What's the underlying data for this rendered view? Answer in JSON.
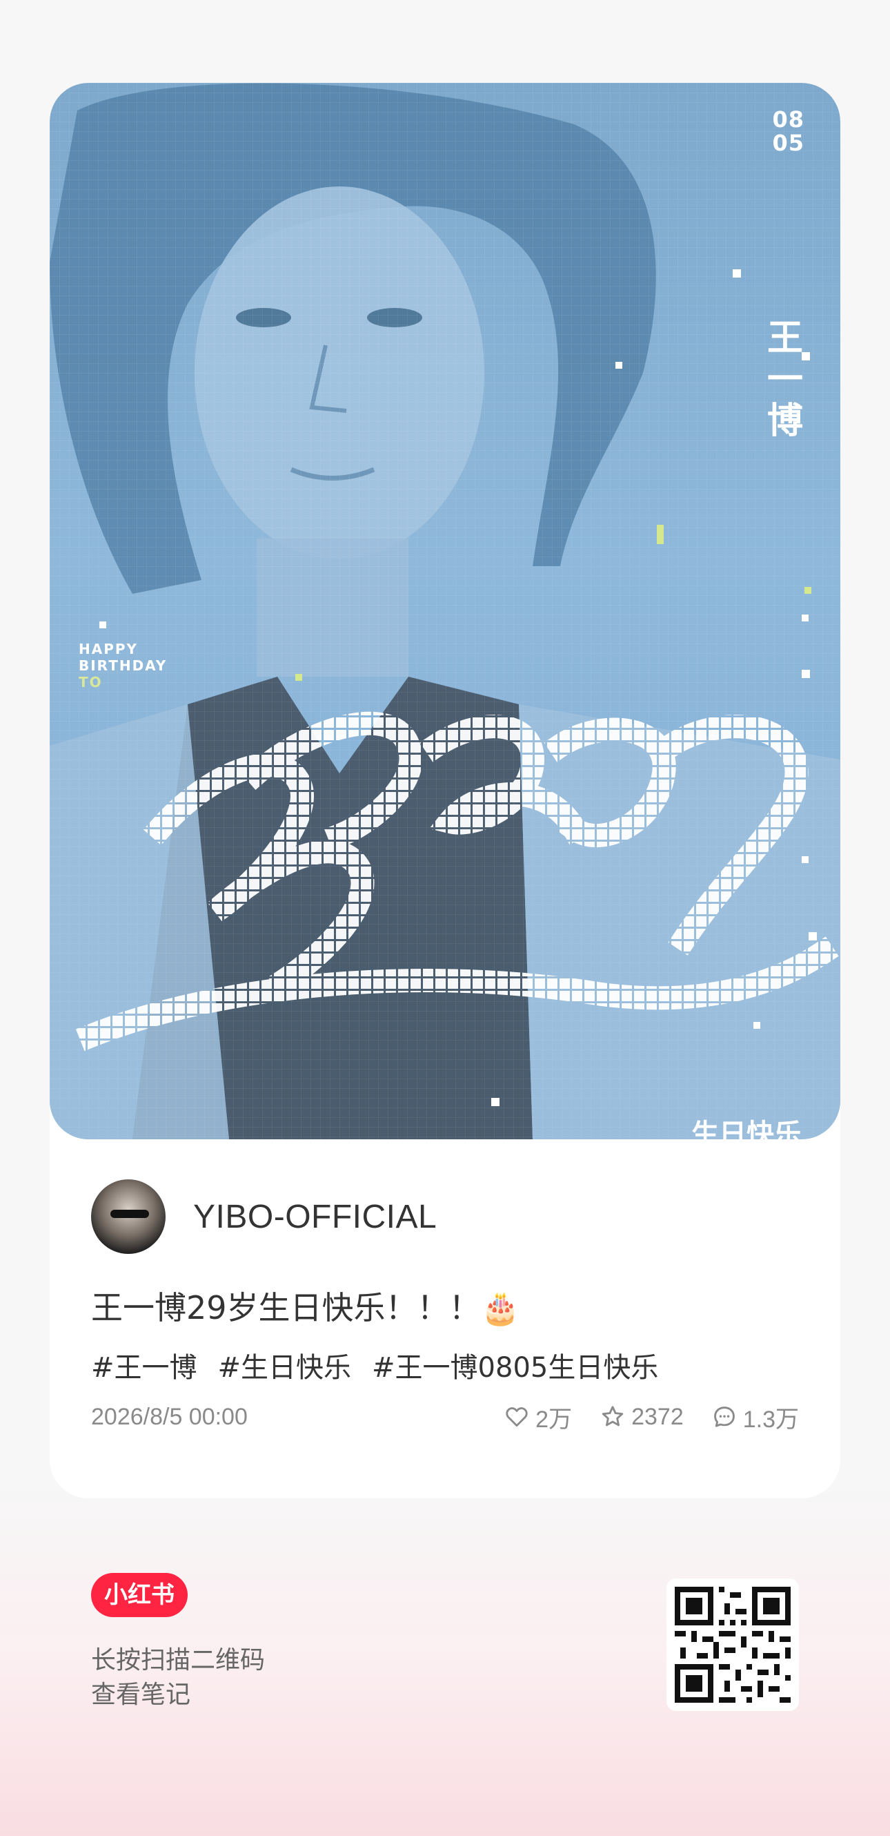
{
  "cover": {
    "date": "08\n05",
    "name": "王一博",
    "greeting": "HAPPY\nBIRTHDAY",
    "greeting_to": "TO",
    "bottom_text": "生日快乐"
  },
  "author": {
    "name": "YIBO-OFFICIAL"
  },
  "post": {
    "title": "王一博29岁生日快乐！！！🎂",
    "tags": [
      "#王一博",
      "#生日快乐",
      "#王一博0805生日快乐"
    ],
    "date": "2026/8/5 00:00",
    "likes": "2万",
    "collects": "2372",
    "comments": "1.3万"
  },
  "footer": {
    "brand": "小红书",
    "hint_line1": "长按扫描二维码",
    "hint_line2": "查看笔记"
  },
  "colors": {
    "brand_red": "#ff2442",
    "cover_blue": "#8fb8da"
  },
  "icons": {
    "like": "heart-icon",
    "collect": "star-icon",
    "comment": "comment-icon"
  }
}
